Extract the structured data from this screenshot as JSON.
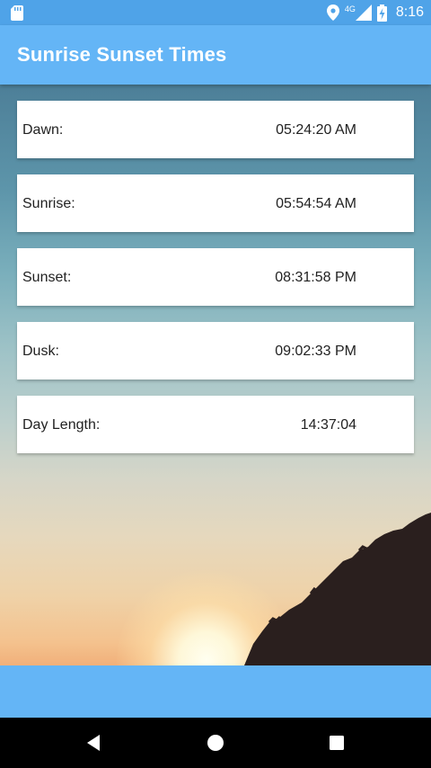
{
  "status_bar": {
    "time": "8:16",
    "network_label": "4G",
    "icons": [
      "sd-card-icon",
      "location-pin-icon",
      "signal-icon",
      "battery-charging-icon"
    ]
  },
  "app_bar": {
    "title": "Sunrise Sunset Times",
    "color": "#64b5f6"
  },
  "times": [
    {
      "label": "Dawn:",
      "value": "05:24:20 AM"
    },
    {
      "label": "Sunrise:",
      "value": "05:54:54 AM"
    },
    {
      "label": "Sunset:",
      "value": "08:31:58 PM"
    },
    {
      "label": "Dusk:",
      "value": "09:02:33 PM"
    },
    {
      "label": "Day Length:",
      "value": "14:37:04"
    }
  ],
  "nav": {
    "buttons": [
      "back-icon",
      "home-icon",
      "recents-icon"
    ]
  }
}
